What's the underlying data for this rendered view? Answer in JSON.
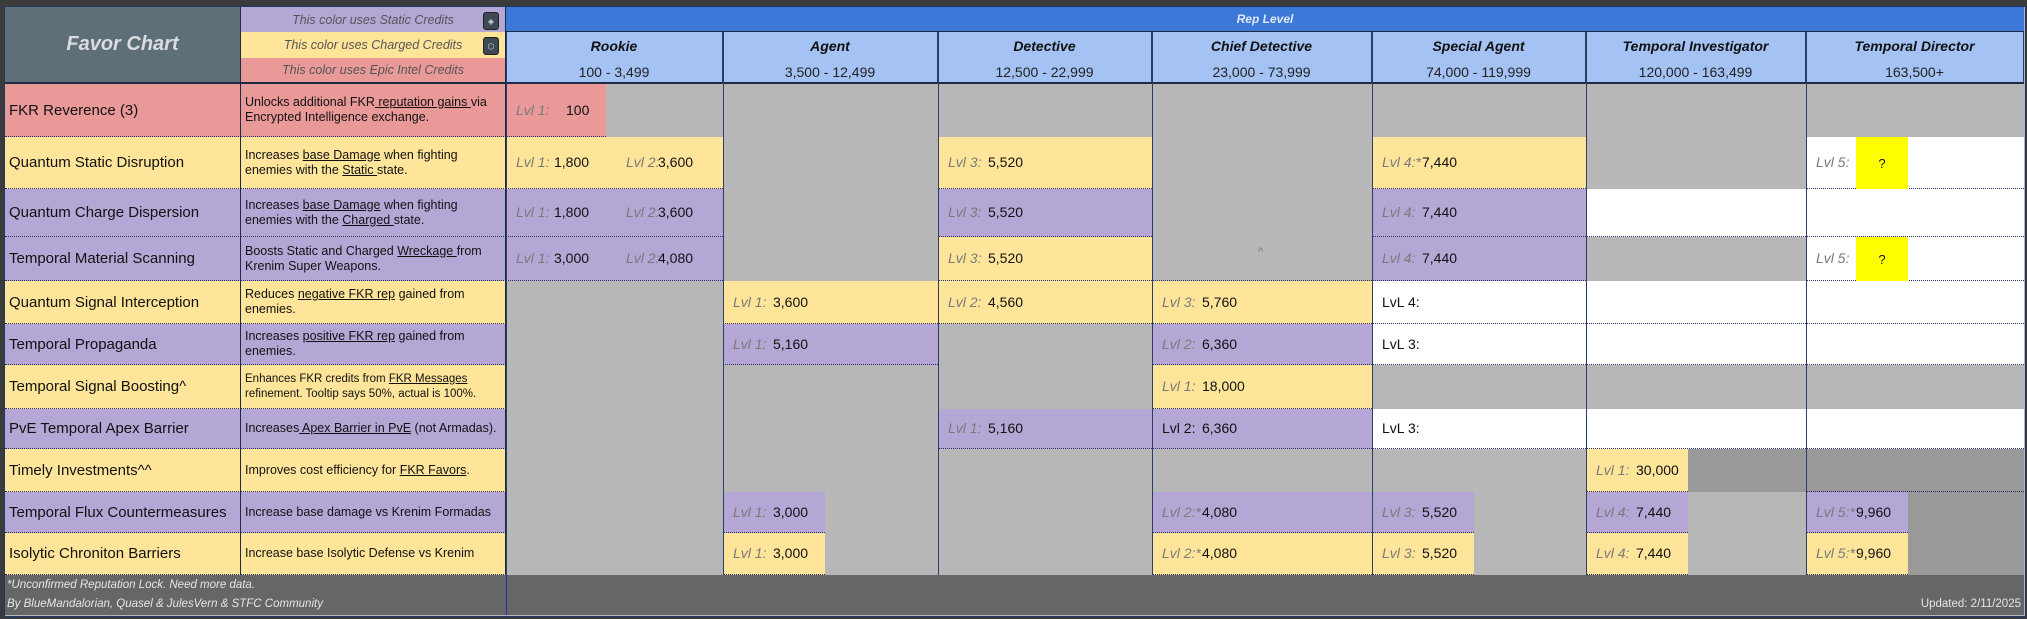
{
  "header": {
    "title": "Favor Chart",
    "legend": [
      {
        "text": "This color uses Static Credits",
        "color": "#b4a7d6",
        "icon": "static-credits-icon"
      },
      {
        "text": "This color uses Charged Credits",
        "color": "#ffe599",
        "icon": "charged-credits-icon"
      },
      {
        "text": "This color uses Epic Intel Credits",
        "color": "#ea9999",
        "icon": ""
      }
    ],
    "rep_level": "Rep Level",
    "ranks": [
      {
        "name": "Rookie",
        "range": "100 - 3,499"
      },
      {
        "name": "Agent",
        "range": "3,500 - 12,499"
      },
      {
        "name": "Detective",
        "range": "12,500 - 22,999"
      },
      {
        "name": "Chief Detective",
        "range": "23,000 - 73,999"
      },
      {
        "name": "Special Agent",
        "range": "74,000 - 119,999"
      },
      {
        "name": "Temporal Investigator",
        "range": "120,000 - 163,499"
      },
      {
        "name": "Temporal Director",
        "range": "163,500+"
      }
    ]
  },
  "colors": {
    "yellow": "#ffe599",
    "purple": "#b4a7d6",
    "pink": "#ea9999",
    "gray": "#b7b7b7",
    "dark": "#999999",
    "white": "#ffffff"
  },
  "rows": [
    {
      "name": "FKR Reverence (3)",
      "color": "pink",
      "desc": [
        {
          "t": "Unlocks additional FKR"
        },
        {
          "t": " reputation gains ",
          "u": true
        },
        {
          "t": "via Encrypted Intelligence exchange."
        }
      ],
      "cells": [
        {
          "bg": "pink",
          "partial": true,
          "entries": [
            {
              "l": "Lvl 1:",
              "v": "100"
            }
          ]
        },
        null,
        null,
        null,
        null,
        null,
        null
      ]
    },
    {
      "name": "Quantum Static Disruption",
      "color": "yellow",
      "desc": [
        {
          "t": "Increases "
        },
        {
          "t": "base Damage",
          "u": true
        },
        {
          "t": " when fighting enemies with the "
        },
        {
          "t": "Static ",
          "u": true
        },
        {
          "t": "state."
        }
      ],
      "cells": [
        {
          "bg": "yellow",
          "entries": [
            {
              "l": "Lvl 1:",
              "v": "1,800"
            },
            {
              "l": "Lvl 2:",
              "v": "3,600"
            }
          ]
        },
        null,
        {
          "bg": "yellow",
          "entries": [
            {
              "l": "Lvl 3:",
              "v": "5,520"
            }
          ]
        },
        null,
        {
          "bg": "yellow",
          "entries": [
            {
              "l": "Lvl 4:*",
              "v": "7,440"
            }
          ]
        },
        null,
        {
          "bg": "white",
          "entries": [
            {
              "l": "Lvl 5:",
              "q": "?"
            }
          ]
        }
      ]
    },
    {
      "name": "Quantum Charge Dispersion",
      "color": "purple",
      "desc": [
        {
          "t": "Increases "
        },
        {
          "t": "base Damage",
          "u": true
        },
        {
          "t": " when fighting enemies with the "
        },
        {
          "t": "Charged ",
          "u": true
        },
        {
          "t": "state."
        }
      ],
      "cells": [
        {
          "bg": "purple",
          "entries": [
            {
              "l": "Lvl 1:",
              "v": "1,800"
            },
            {
              "l": "Lvl 2:",
              "v": "3,600"
            }
          ]
        },
        null,
        {
          "bg": "purple",
          "entries": [
            {
              "l": "Lvl 3:",
              "v": "5,520"
            }
          ]
        },
        null,
        {
          "bg": "purple",
          "entries": [
            {
              "l": "Lvl 4:",
              "v": "7,440"
            }
          ]
        },
        {
          "bg": "white"
        },
        {
          "bg": "white"
        }
      ]
    },
    {
      "name": "Temporal Material Scanning",
      "color": "purple",
      "desc": [
        {
          "t": "Boosts Static and Charged "
        },
        {
          "t": "Wreckage ",
          "u": true
        },
        {
          "t": "from Krenim Super Weapons."
        }
      ],
      "cells": [
        {
          "bg": "purple",
          "entries": [
            {
              "l": "Lvl 1:",
              "v": "3,000"
            },
            {
              "l": "Lvl 2:",
              "v": "4,080"
            }
          ]
        },
        null,
        {
          "bg": "yellow",
          "entries": [
            {
              "l": "Lvl 3:",
              "v": "5,520"
            }
          ]
        },
        {
          "bg": "gray",
          "note": "^"
        },
        {
          "bg": "purple",
          "entries": [
            {
              "l": "Lvl 4:",
              "v": "7,440"
            }
          ]
        },
        null,
        {
          "bg": "white",
          "entries": [
            {
              "l": "Lvl 5:",
              "q": "?"
            }
          ]
        }
      ]
    },
    {
      "name": "Quantum Signal Interception",
      "color": "yellow",
      "desc": [
        {
          "t": "Reduces "
        },
        {
          "t": "negative FKR rep",
          "u": true
        },
        {
          "t": " gained from enemies."
        }
      ],
      "cells": [
        null,
        {
          "bg": "yellow",
          "entries": [
            {
              "l": "Lvl 1:",
              "v": "3,600"
            }
          ]
        },
        {
          "bg": "yellow",
          "entries": [
            {
              "l": "Lvl 2:",
              "v": "4,560"
            }
          ]
        },
        {
          "bg": "yellow",
          "entries": [
            {
              "l": "Lvl 3:",
              "v": "5,760"
            }
          ]
        },
        {
          "bg": "white",
          "entries": [
            {
              "l": "LvL 4:",
              "plain": true
            }
          ]
        },
        {
          "bg": "white"
        },
        {
          "bg": "white"
        }
      ]
    },
    {
      "name": "Temporal Propaganda",
      "color": "purple",
      "desc": [
        {
          "t": "Increases "
        },
        {
          "t": "positive FKR rep",
          "u": true
        },
        {
          "t": " gained from enemies."
        }
      ],
      "cells": [
        null,
        {
          "bg": "purple",
          "entries": [
            {
              "l": "Lvl 1:",
              "v": "5,160"
            }
          ]
        },
        null,
        {
          "bg": "purple",
          "entries": [
            {
              "l": "Lvl 2:",
              "v": "6,360"
            }
          ]
        },
        {
          "bg": "white",
          "entries": [
            {
              "l": "LvL 3:",
              "plain": true
            }
          ]
        },
        {
          "bg": "white"
        },
        {
          "bg": "white"
        }
      ]
    },
    {
      "name": "Temporal Signal Boosting^",
      "color": "yellow",
      "small": true,
      "desc": [
        {
          "t": "Enhances FKR credits from "
        },
        {
          "t": "FKR Messages",
          "u": true
        },
        {
          "t": " refinement. Tooltip says 50%, actual is 100%."
        }
      ],
      "cells": [
        null,
        null,
        null,
        {
          "bg": "yellow",
          "entries": [
            {
              "l": "Lvl 1:",
              "v": "18,000"
            }
          ]
        },
        null,
        null,
        null
      ]
    },
    {
      "name": "PvE Temporal Apex Barrier",
      "color": "purple",
      "desc": [
        {
          "t": "Increases"
        },
        {
          "t": " Apex Barrier in PvE",
          "u": true
        },
        {
          "t": " (not Armadas)."
        }
      ],
      "cells": [
        null,
        null,
        {
          "bg": "purple",
          "entries": [
            {
              "l": "Lvl 1:",
              "v": "5,160"
            }
          ]
        },
        {
          "bg": "purple",
          "entries": [
            {
              "l": "Lvl 2:",
              "v": "6,360",
              "plain": true
            }
          ]
        },
        {
          "bg": "white",
          "entries": [
            {
              "l": "LvL 3:",
              "plain": true
            }
          ]
        },
        {
          "bg": "white"
        },
        {
          "bg": "white"
        }
      ]
    },
    {
      "name": "Timely Investments^^",
      "color": "yellow",
      "desc": [
        {
          "t": "Improves cost efficiency for "
        },
        {
          "t": "FKR Favors",
          "u": true
        },
        {
          "t": "."
        }
      ],
      "cells": [
        null,
        null,
        null,
        null,
        null,
        {
          "bg": "yellow",
          "partial": true,
          "rest": "dark",
          "entries": [
            {
              "l": "Lvl 1:",
              "v": "30,000"
            }
          ]
        },
        {
          "bg": "dark"
        }
      ]
    },
    {
      "name": "Temporal Flux Countermeasures",
      "color": "purple",
      "desc": [
        {
          "t": "Increase base damage vs Krenim Formadas"
        }
      ],
      "cells": [
        null,
        {
          "bg": "purple",
          "partial": true,
          "entries": [
            {
              "l": "Lvl 1:",
              "v": "3,000"
            }
          ]
        },
        null,
        {
          "bg": "purple",
          "entries": [
            {
              "l": "Lvl 2:*",
              "v": "4,080"
            }
          ]
        },
        {
          "bg": "purple",
          "partial": true,
          "entries": [
            {
              "l": "Lvl 3:",
              "v": "5,520"
            }
          ]
        },
        {
          "bg": "purple",
          "partial": true,
          "entries": [
            {
              "l": "Lvl 4:",
              "v": "7,440"
            }
          ]
        },
        {
          "bg": "purple",
          "partial": true,
          "rest": "dark",
          "entries": [
            {
              "l": "Lvl 5:*",
              "v": "9,960"
            }
          ]
        }
      ]
    },
    {
      "name": "Isolytic Chroniton Barriers",
      "color": "yellow",
      "desc": [
        {
          "t": "Increase base Isolytic Defense vs Krenim"
        }
      ],
      "cells": [
        null,
        {
          "bg": "yellow",
          "partial": true,
          "entries": [
            {
              "l": "Lvl 1:",
              "v": "3,000"
            }
          ]
        },
        null,
        {
          "bg": "yellow",
          "entries": [
            {
              "l": "Lvl 2:*",
              "v": "4,080"
            }
          ]
        },
        {
          "bg": "yellow",
          "partial": true,
          "entries": [
            {
              "l": "Lvl 3:",
              "v": "5,520"
            }
          ]
        },
        {
          "bg": "yellow",
          "partial": true,
          "entries": [
            {
              "l": "Lvl 4:",
              "v": "7,440"
            }
          ]
        },
        {
          "bg": "yellow",
          "partial": true,
          "rest": "dark",
          "entries": [
            {
              "l": "Lvl 5:*",
              "v": "9,960"
            }
          ]
        }
      ]
    }
  ],
  "footer": {
    "note": "*Unconfirmed Reputation Lock. Need more data.",
    "credits": "By BlueMandalorian, Quasel & JulesVern & STFC Community",
    "updated": "Updated: 2/11/2025"
  }
}
